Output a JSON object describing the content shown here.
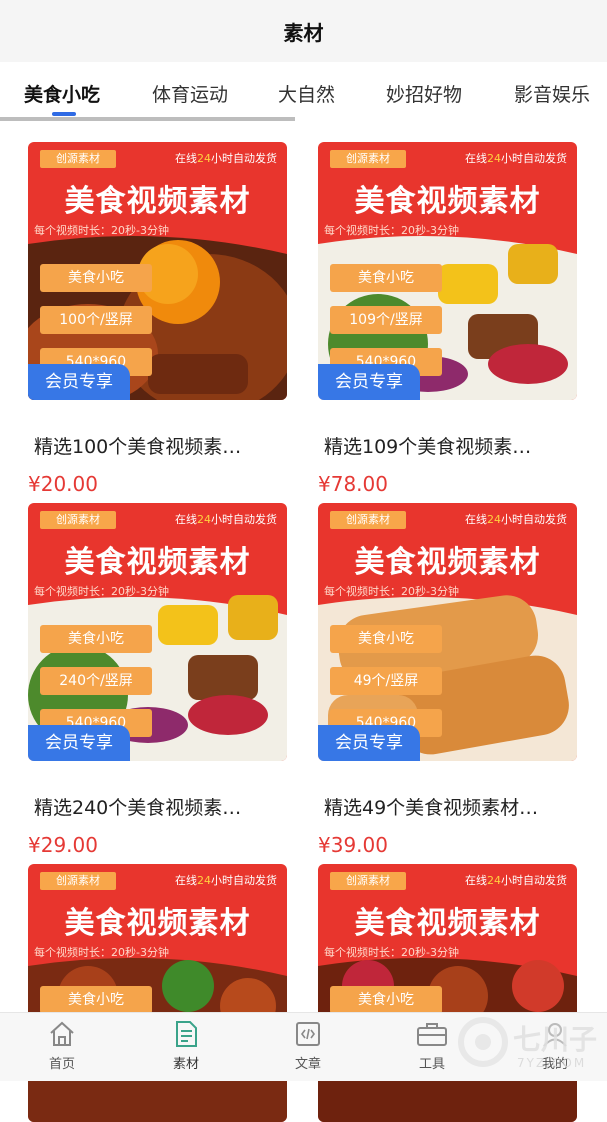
{
  "header": {
    "title": "素材"
  },
  "tabs": [
    {
      "label": "美食小吃",
      "active": true
    },
    {
      "label": "体育运动",
      "active": false
    },
    {
      "label": "大自然",
      "active": false
    },
    {
      "label": "妙招好物",
      "active": false
    },
    {
      "label": "影音娱乐",
      "active": false
    }
  ],
  "banner": {
    "tag": "创源素材",
    "ship_prefix": "在线",
    "ship_highlight": "24",
    "ship_suffix": "小时自动发货",
    "headline": "美食视频素材",
    "duration": "每个视频时长：20秒-3分钟",
    "chip_category": "美食小吃",
    "chip_resolution": "540*960",
    "vip_label": "会员专享"
  },
  "products": [
    {
      "chip_count": "100个/竖屏",
      "name": "精选100个美食视频素…",
      "price": "¥20.00"
    },
    {
      "chip_count": "109个/竖屏",
      "name": "精选109个美食视频素…",
      "price": "¥78.00"
    },
    {
      "chip_count": "240个/竖屏",
      "name": "精选240个美食视频素…",
      "price": "¥29.00"
    },
    {
      "chip_count": "49个/竖屏",
      "name": "精选49个美食视频素材…",
      "price": "¥39.00"
    },
    {
      "chip_count": "",
      "name": "",
      "price": ""
    },
    {
      "chip_count": "",
      "name": "",
      "price": ""
    }
  ],
  "bottom_nav": [
    {
      "label": "首页",
      "icon": "home-icon"
    },
    {
      "label": "素材",
      "icon": "material-icon",
      "active": true
    },
    {
      "label": "文章",
      "icon": "article-icon"
    },
    {
      "label": "工具",
      "icon": "toolbox-icon"
    },
    {
      "label": "我的",
      "icon": "profile-icon"
    }
  ],
  "watermark": {
    "text": "七川子",
    "sub": "7YZ.COM"
  },
  "colors": {
    "accent": "#2f6be5",
    "price": "#e53935",
    "banner_red": "#e8352d",
    "chip_orange": "#f5a44b",
    "vip_blue": "#3777e6"
  }
}
